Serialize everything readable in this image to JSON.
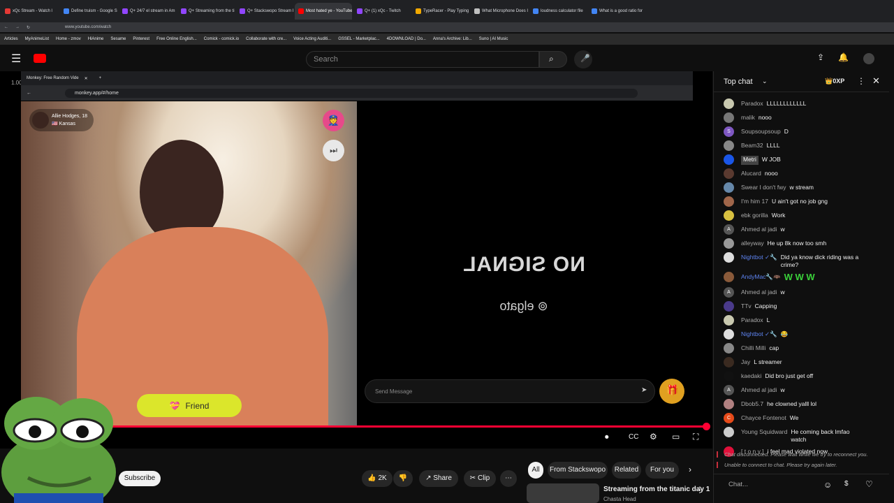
{
  "browser": {
    "tabs": [
      {
        "label": "xQc Stream - Watch l",
        "color": "#e53935"
      },
      {
        "label": "Define truism - Google Se",
        "color": "#4285f4"
      },
      {
        "label": "Q+ 24/7 el stream in Am",
        "color": "#9146ff"
      },
      {
        "label": "Q+ Streaming from the ti",
        "color": "#9146ff"
      },
      {
        "label": "Q+ Stackswopo Stream R",
        "color": "#9146ff"
      },
      {
        "label": "Most hated ye - YouTube",
        "color": "#ff0000"
      },
      {
        "label": "Q+ (1) xQc - Twitch",
        "color": "#9146ff"
      },
      {
        "label": "TypeRacer - Play Typing G",
        "color": "#f2a900"
      },
      {
        "label": "What Microphone Does I",
        "color": "#c0c0c0"
      },
      {
        "label": "loudness calculator file",
        "color": "#4285f4"
      },
      {
        "label": "What is a good ratio for",
        "color": "#4285f4"
      }
    ],
    "active_tab_index": 5,
    "url": "www.youtube.com/watch",
    "bookmarks": [
      "Articles",
      "MyAnimeList",
      "Home - zmov",
      "HiAnime",
      "Sesame",
      "Pinterest",
      "Free Online English...",
      "Comick - comick.io",
      "Collaborate with cre...",
      "Voice Acting Auditi...",
      "GSSEL - Marketplac...",
      "4DOWNLOAD | Do...",
      "Anna's Archive: Lib...",
      "Suno | AI Music"
    ]
  },
  "youtube": {
    "search_placeholder": "Search",
    "subscribe_label": "Subscribe",
    "like_count": "2K",
    "share_label": "Share",
    "clip_label": "Clip",
    "filter_chips": [
      "All",
      "From Stackswopo",
      "Related",
      "For you"
    ],
    "related_video_title": "Streaming from the titanic day 1",
    "related_video_channel": "Chasta Head",
    "corner_label": "1.00"
  },
  "inner_browser": {
    "tab_title": "Monkey: Free Random Vide",
    "url": "monkey.app/#/home"
  },
  "monkey": {
    "user_name": "Allie Hodges, 18",
    "user_location": "🇺🇸 Kansas",
    "no_signal_text": "NO SIGNAL",
    "elgato_text": "⊚ elgato",
    "send_placeholder": "Send Message",
    "friend_label": "Friend"
  },
  "chat": {
    "title": "Top chat",
    "points": "0XP",
    "messages": [
      {
        "author": "Paradox",
        "text": "LLLLLLLLLLLL",
        "avatar_color": "#c9c9b0",
        "mod": false
      },
      {
        "author": "malik",
        "text": "nooo",
        "avatar_color": "#777",
        "mod": false
      },
      {
        "author": "Soupsoupsoup",
        "text": "D",
        "avatar_color": "#7e57c2",
        "mod": false,
        "initial": "S"
      },
      {
        "author": "Beam32",
        "text": "LLLL",
        "avatar_color": "#888",
        "mod": false
      },
      {
        "author": "Metri",
        "text": "W JOB",
        "avatar_color": "#1a56e8",
        "mod": false,
        "member": true
      },
      {
        "author": "Alucard",
        "text": "nooo",
        "avatar_color": "#5a3a30",
        "mod": false
      },
      {
        "author": "Swear I don't fwy",
        "text": "w stream",
        "avatar_color": "#6688aa",
        "mod": false
      },
      {
        "author": "I'm him 17",
        "text": "U ain't got no job gng",
        "avatar_color": "#a0664a",
        "mod": false
      },
      {
        "author": "ebk gorilla",
        "text": "Work",
        "avatar_color": "#d8c040",
        "mod": false
      },
      {
        "author": "Ahmed al jadi",
        "text": "w",
        "avatar_color": "#555",
        "mod": false,
        "initial": "A"
      },
      {
        "author": "alleyway",
        "text": "He up 8k now too smh",
        "avatar_color": "#999",
        "mod": false
      },
      {
        "author": "Nightbot ✓🔧",
        "text": "Did ya know dick riding was a crime?",
        "avatar_color": "#ddd",
        "mod": true
      },
      {
        "author": "AndyMac🔧🦇",
        "text": "W W W",
        "avatar_color": "#8a5a3a",
        "mod": true,
        "green": true
      },
      {
        "author": "Ahmed al jadi",
        "text": "w",
        "avatar_color": "#555",
        "mod": false,
        "initial": "A"
      },
      {
        "author": "TTv",
        "text": "Capping",
        "avatar_color": "#4a3a8a",
        "mod": false
      },
      {
        "author": "Paradox",
        "text": "L",
        "avatar_color": "#c9c9b0",
        "mod": false
      },
      {
        "author": "Nightbot ✓🔧",
        "text": "😂",
        "avatar_color": "#ddd",
        "mod": true
      },
      {
        "author": "Chilli Milli",
        "text": "cap",
        "avatar_color": "#888",
        "mod": false
      },
      {
        "author": "Jay",
        "text": "L streamer",
        "avatar_color": "#3a2a20",
        "mod": false
      },
      {
        "author": "kaedaki",
        "text": "Did bro just get off",
        "avatar_color": "#111",
        "mod": false
      },
      {
        "author": "Ahmed al jadi",
        "text": "w",
        "avatar_color": "#555",
        "mod": false,
        "initial": "A"
      },
      {
        "author": "Dbob5.7",
        "text": "he clowned yalll lol",
        "avatar_color": "#b08080",
        "mod": false
      },
      {
        "author": "Chayce Fontenot",
        "text": "We",
        "avatar_color": "#e64a19",
        "mod": false,
        "initial": "C"
      },
      {
        "author": "Young Squidward",
        "text": "He coming back lmfao watch",
        "avatar_color": "#ccc",
        "mod": false
      },
      {
        "author": "[ t o n y ]",
        "text": "i feel mad violated now",
        "avatar_color": "#e0103a",
        "mod": false
      }
    ],
    "system_messages": [
      "Chat disconnected. Please wait while we try to reconnect you.",
      "Unable to connect to chat. Please try again later."
    ],
    "input_placeholder": "Chat..."
  }
}
